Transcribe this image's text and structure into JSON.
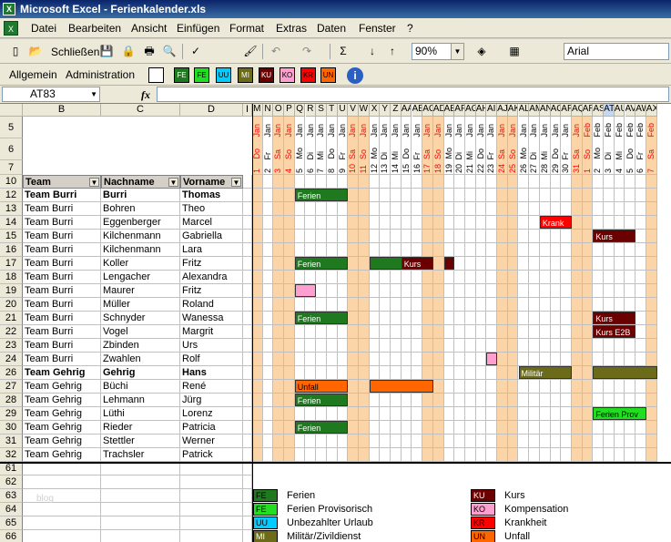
{
  "window": {
    "title": "Microsoft Excel - Ferienkalender.xls"
  },
  "menu": [
    "Datei",
    "Bearbeiten",
    "Ansicht",
    "Einfügen",
    "Format",
    "Extras",
    "Daten",
    "Fenster",
    "?"
  ],
  "toolbar1": {
    "close_label": "Schließen",
    "zoom": "90%",
    "font": "Arial"
  },
  "toolbar2": {
    "allgemein": "Allgemein",
    "administration": "Administration",
    "legend_buttons": [
      "FE",
      "FE",
      "UU",
      "MI",
      "KU",
      "KO",
      "KR",
      "UN"
    ]
  },
  "formula": {
    "namebox": "AT83",
    "fx": "fx"
  },
  "columns": {
    "row_col": "",
    "B": "B",
    "C": "C",
    "D": "D",
    "I": "I",
    "days": [
      "M",
      "N",
      "O",
      "P",
      "Q",
      "R",
      "S",
      "T",
      "U",
      "V",
      "W",
      "X",
      "Y",
      "Z",
      "AA",
      "AB",
      "AC",
      "AD",
      "AE",
      "AF",
      "AG",
      "AH",
      "AI",
      "AJ",
      "AK",
      "AL",
      "AM",
      "AN",
      "AO",
      "AP",
      "AQ",
      "AR",
      "AS",
      "AT",
      "AU",
      "AV",
      "AW",
      "AX"
    ]
  },
  "day_headers": {
    "month": [
      "Jan",
      "Jan",
      "Jan",
      "Jan",
      "Jan",
      "Jan",
      "Jan",
      "Jan",
      "Jan",
      "Jan",
      "Jan",
      "Jan",
      "Jan",
      "Jan",
      "Jan",
      "Jan",
      "Jan",
      "Jan",
      "Jan",
      "Jan",
      "Jan",
      "Jan",
      "Jan",
      "Jan",
      "Jan",
      "Jan",
      "Jan",
      "Jan",
      "Jan",
      "Jan",
      "Jan",
      "Feb",
      "Feb",
      "Feb",
      "Feb",
      "Feb",
      "Feb",
      "Feb"
    ],
    "weekday": [
      "Do",
      "Fr",
      "Sa",
      "So",
      "Mo",
      "Di",
      "Mi",
      "Do",
      "Fr",
      "Sa",
      "So",
      "Mo",
      "Di",
      "Mi",
      "Do",
      "Fr",
      "Sa",
      "So",
      "Mo",
      "Di",
      "Mi",
      "Do",
      "Fr",
      "Sa",
      "So",
      "Mo",
      "Di",
      "Mi",
      "Do",
      "Fr",
      "Sa",
      "So",
      "Mo",
      "Di",
      "Mi",
      "Do",
      "Fr",
      "Sa"
    ],
    "day": [
      "1",
      "2",
      "3",
      "4",
      "5",
      "6",
      "7",
      "8",
      "9",
      "10",
      "11",
      "12",
      "13",
      "14",
      "15",
      "16",
      "17",
      "18",
      "19",
      "20",
      "21",
      "22",
      "23",
      "24",
      "25",
      "26",
      "27",
      "28",
      "29",
      "30",
      "31",
      "1",
      "2",
      "3",
      "4",
      "5",
      "6",
      "7"
    ],
    "weekend": [
      true,
      false,
      true,
      true,
      false,
      false,
      false,
      false,
      false,
      true,
      true,
      false,
      false,
      false,
      false,
      false,
      true,
      true,
      false,
      false,
      false,
      false,
      false,
      true,
      true,
      false,
      false,
      false,
      false,
      false,
      true,
      true,
      false,
      false,
      false,
      false,
      false,
      true
    ]
  },
  "table_headers": {
    "team": "Team",
    "nachname": "Nachname",
    "vorname": "Vorname"
  },
  "rows": [
    {
      "num": "5",
      "team": "",
      "nachname": "",
      "vorname": ""
    },
    {
      "num": "6",
      "team": "",
      "nachname": "",
      "vorname": ""
    },
    {
      "num": "7",
      "team": "",
      "nachname": "",
      "vorname": ""
    },
    {
      "num": "10",
      "team": "Team",
      "nachname": "Nachname",
      "vorname": "Vorname",
      "header": true
    },
    {
      "num": "12",
      "team": "Team Burri",
      "nachname": "Burri",
      "vorname": "Thomas",
      "bold": true
    },
    {
      "num": "13",
      "team": "Team Burri",
      "nachname": "Bohren",
      "vorname": "Theo"
    },
    {
      "num": "14",
      "team": "Team Burri",
      "nachname": "Eggenberger",
      "vorname": "Marcel"
    },
    {
      "num": "15",
      "team": "Team Burri",
      "nachname": "Kilchenmann",
      "vorname": "Gabriella"
    },
    {
      "num": "16",
      "team": "Team Burri",
      "nachname": "Kilchenmann",
      "vorname": "Lara"
    },
    {
      "num": "17",
      "team": "Team Burri",
      "nachname": "Koller",
      "vorname": "Fritz"
    },
    {
      "num": "18",
      "team": "Team Burri",
      "nachname": "Lengacher",
      "vorname": "Alexandra"
    },
    {
      "num": "19",
      "team": "Team Burri",
      "nachname": "Maurer",
      "vorname": "Fritz"
    },
    {
      "num": "20",
      "team": "Team Burri",
      "nachname": "Müller",
      "vorname": "Roland"
    },
    {
      "num": "21",
      "team": "Team Burri",
      "nachname": "Schnyder",
      "vorname": "Wanessa"
    },
    {
      "num": "22",
      "team": "Team Burri",
      "nachname": "Vogel",
      "vorname": "Margrit"
    },
    {
      "num": "23",
      "team": "Team Burri",
      "nachname": "Zbinden",
      "vorname": "Urs"
    },
    {
      "num": "24",
      "team": "Team Burri",
      "nachname": "Zwahlen",
      "vorname": "Rolf"
    },
    {
      "num": "26",
      "team": "Team Gehrig",
      "nachname": "Gehrig",
      "vorname": "Hans",
      "bold": true
    },
    {
      "num": "27",
      "team": "Team Gehrig",
      "nachname": "Büchi",
      "vorname": "René"
    },
    {
      "num": "28",
      "team": "Team Gehrig",
      "nachname": "Lehmann",
      "vorname": "Jürg"
    },
    {
      "num": "29",
      "team": "Team Gehrig",
      "nachname": "Lüthi",
      "vorname": "Lorenz"
    },
    {
      "num": "30",
      "team": "Team Gehrig",
      "nachname": "Rieder",
      "vorname": "Patricia"
    },
    {
      "num": "31",
      "team": "Team Gehrig",
      "nachname": "Stettler",
      "vorname": "Werner"
    },
    {
      "num": "32",
      "team": "Team Gehrig",
      "nachname": "Trachsler",
      "vorname": "Patrick"
    },
    {
      "num": "61",
      "team": "",
      "nachname": "",
      "vorname": ""
    },
    {
      "num": "62",
      "team": "",
      "nachname": "",
      "vorname": ""
    },
    {
      "num": "63",
      "team": "",
      "nachname": "",
      "vorname": ""
    },
    {
      "num": "64",
      "team": "",
      "nachname": "",
      "vorname": ""
    },
    {
      "num": "65",
      "team": "",
      "nachname": "",
      "vorname": ""
    },
    {
      "num": "66",
      "team": "",
      "nachname": "",
      "vorname": ""
    }
  ],
  "bars": [
    {
      "row": "12",
      "start": 4,
      "len": 5,
      "label": "Ferien",
      "color": "#1f7a1f"
    },
    {
      "row": "14",
      "start": 27,
      "len": 3,
      "label": "Krank",
      "color": "#ff0000"
    },
    {
      "row": "15",
      "start": 32,
      "len": 4,
      "label": "Kurs",
      "color": "#6b0000"
    },
    {
      "row": "17",
      "start": 4,
      "len": 5,
      "label": "Ferien",
      "color": "#1f7a1f"
    },
    {
      "row": "17",
      "start": 11,
      "len": 5,
      "label": "",
      "color": "#1f7a1f"
    },
    {
      "row": "17",
      "start": 14,
      "len": 3,
      "label": "Kurs",
      "color": "#6b0000"
    },
    {
      "row": "17",
      "start": 18,
      "len": 1,
      "label": "",
      "color": "#6b0000"
    },
    {
      "row": "19",
      "start": 4,
      "len": 2,
      "label": "",
      "color": "#ff9fcf"
    },
    {
      "row": "21",
      "start": 4,
      "len": 5,
      "label": "Ferien",
      "color": "#1f7a1f"
    },
    {
      "row": "21",
      "start": 32,
      "len": 4,
      "label": "Kurs",
      "color": "#6b0000"
    },
    {
      "row": "22",
      "start": 32,
      "len": 4,
      "label": "Kurs E2B",
      "color": "#6b0000"
    },
    {
      "row": "24",
      "start": 22,
      "len": 1,
      "label": "",
      "color": "#ff9fcf"
    },
    {
      "row": "26",
      "start": 25,
      "len": 5,
      "label": "Militär",
      "color": "#6b6b1a"
    },
    {
      "row": "26",
      "start": 32,
      "len": 6,
      "label": "",
      "color": "#6b6b1a"
    },
    {
      "row": "27",
      "start": 4,
      "len": 5,
      "label": "Unfall",
      "color": "#ff6600"
    },
    {
      "row": "27",
      "start": 11,
      "len": 6,
      "label": "",
      "color": "#ff6600"
    },
    {
      "row": "28",
      "start": 4,
      "len": 5,
      "label": "Ferien",
      "color": "#1f7a1f"
    },
    {
      "row": "29",
      "start": 32,
      "len": 5,
      "label": "Ferien Prov",
      "color": "#22dd22"
    },
    {
      "row": "30",
      "start": 4,
      "len": 5,
      "label": "Ferien",
      "color": "#1f7a1f"
    }
  ],
  "legend": [
    {
      "code": "FE",
      "label": "Ferien",
      "color": "#1f7a1f",
      "text": "#000"
    },
    {
      "code": "FE",
      "label": "Ferien Provisorisch",
      "color": "#22dd22",
      "text": "#000"
    },
    {
      "code": "UU",
      "label": "Unbezahlter Urlaub",
      "color": "#00ccff",
      "text": "#000"
    },
    {
      "code": "MI",
      "label": "Militär/Zivildienst",
      "color": "#6b6b1a",
      "text": "#fff"
    },
    {
      "code": "KU",
      "label": "Kurs",
      "color": "#6b0000",
      "text": "#fff"
    },
    {
      "code": "KO",
      "label": "Kompensation",
      "color": "#ff9fcf",
      "text": "#000"
    },
    {
      "code": "KR",
      "label": "Krankheit",
      "color": "#ff0000",
      "text": "#000"
    },
    {
      "code": "UN",
      "label": "Unfall",
      "color": "#ff6600",
      "text": "#000"
    }
  ],
  "watermark": "blog",
  "colors": {
    "weekend": "#fbd5a8",
    "weekend_text": "#ff0000",
    "weekday_text": "#000000"
  }
}
